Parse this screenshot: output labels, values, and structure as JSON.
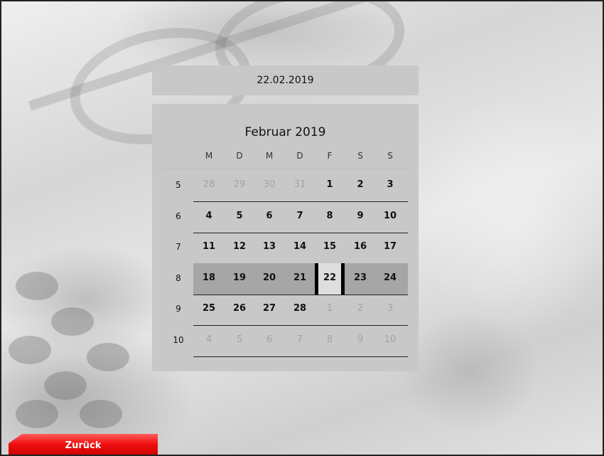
{
  "date_field": {
    "value": "22.02.2019"
  },
  "calendar": {
    "month_title": "Februar 2019",
    "weekday_headers": [
      "M",
      "D",
      "M",
      "D",
      "F",
      "S",
      "S"
    ],
    "weeks": [
      {
        "week": "5",
        "days": [
          {
            "d": "28",
            "other": true
          },
          {
            "d": "29",
            "other": true
          },
          {
            "d": "30",
            "other": true
          },
          {
            "d": "31",
            "other": true
          },
          {
            "d": "1"
          },
          {
            "d": "2"
          },
          {
            "d": "3"
          }
        ]
      },
      {
        "week": "6",
        "days": [
          {
            "d": "4"
          },
          {
            "d": "5"
          },
          {
            "d": "6"
          },
          {
            "d": "7"
          },
          {
            "d": "8"
          },
          {
            "d": "9"
          },
          {
            "d": "10"
          }
        ]
      },
      {
        "week": "7",
        "days": [
          {
            "d": "11"
          },
          {
            "d": "12"
          },
          {
            "d": "13"
          },
          {
            "d": "14"
          },
          {
            "d": "15"
          },
          {
            "d": "16"
          },
          {
            "d": "17"
          }
        ]
      },
      {
        "week": "8",
        "days": [
          {
            "d": "18"
          },
          {
            "d": "19"
          },
          {
            "d": "20"
          },
          {
            "d": "21"
          },
          {
            "d": "22",
            "selected": true
          },
          {
            "d": "23"
          },
          {
            "d": "24"
          }
        ],
        "highlighted": true
      },
      {
        "week": "9",
        "days": [
          {
            "d": "25"
          },
          {
            "d": "26"
          },
          {
            "d": "27"
          },
          {
            "d": "28"
          },
          {
            "d": "1",
            "other": true
          },
          {
            "d": "2",
            "other": true
          },
          {
            "d": "3",
            "other": true
          }
        ]
      },
      {
        "week": "10",
        "days": [
          {
            "d": "4",
            "other": true
          },
          {
            "d": "5",
            "other": true
          },
          {
            "d": "6",
            "other": true
          },
          {
            "d": "7",
            "other": true
          },
          {
            "d": "8",
            "other": true
          },
          {
            "d": "9",
            "other": true
          },
          {
            "d": "10",
            "other": true
          }
        ]
      }
    ]
  },
  "back_button": {
    "label": "Zurück"
  },
  "colors": {
    "panel": "#c8c8c8",
    "week_highlight": "#a6a6a6",
    "selected_day": "#dedede",
    "back_button": "#ef0e0e"
  },
  "icons": [
    "background-photo"
  ]
}
